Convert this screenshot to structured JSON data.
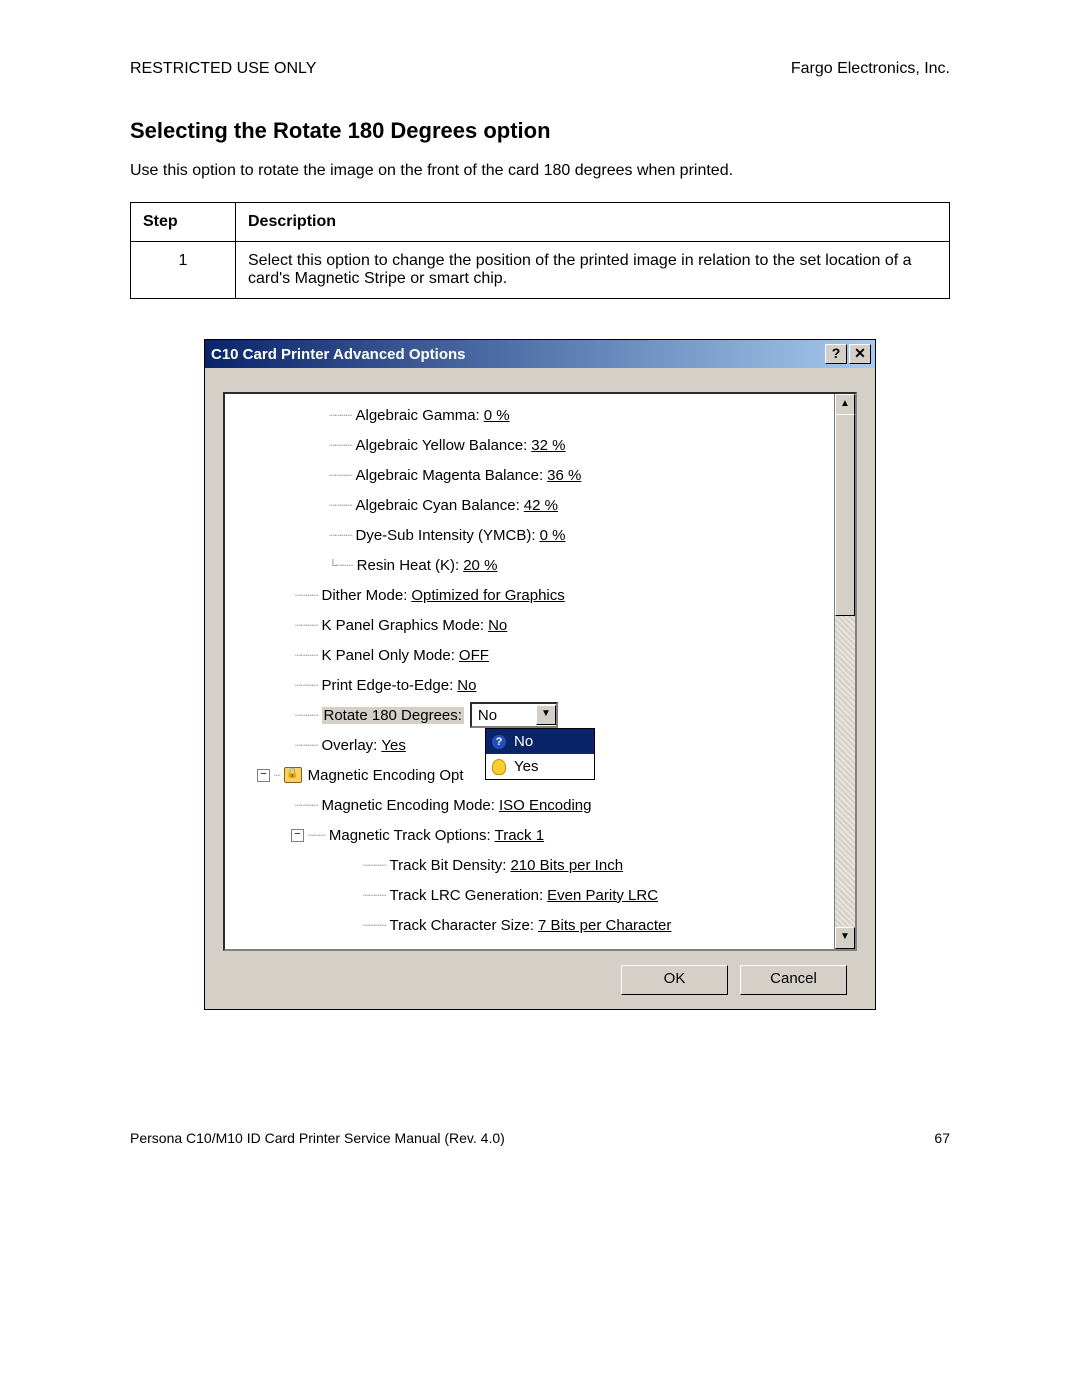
{
  "doc": {
    "restricted": "RESTRICTED USE ONLY",
    "company": "Fargo Electronics, Inc.",
    "heading": "Selecting the Rotate 180 Degrees option",
    "intro": "Use this option to rotate the image on the front of the card 180 degrees when printed.",
    "table": {
      "h_step": "Step",
      "h_desc": "Description",
      "r1_step": "1",
      "r1_desc": "Select this option to change the position of the printed image in relation to the set location of a card's Magnetic Stripe or smart chip."
    },
    "footer_left": "Persona C10/M10 ID Card Printer Service Manual (Rev. 4.0)",
    "page_num": "67"
  },
  "dialog": {
    "title": "C10 Card Printer Advanced Options",
    "help_glyph": "?",
    "close_glyph": "✕",
    "ok": "OK",
    "cancel": "Cancel",
    "scroll_up": "▲",
    "scroll_down": "▼",
    "dd_arrow": "▼",
    "expand_minus": "−",
    "tree": {
      "alg_gamma_lbl": "Algebraic Gamma: ",
      "alg_gamma_val": "0 %",
      "alg_yellow_lbl": "Algebraic Yellow Balance: ",
      "alg_yellow_val": "32 %",
      "alg_magenta_lbl": "Algebraic Magenta Balance: ",
      "alg_magenta_val": "36 %",
      "alg_cyan_lbl": "Algebraic Cyan Balance: ",
      "alg_cyan_val": "42 %",
      "dyesub_lbl": "Dye-Sub Intensity (YMCB): ",
      "dyesub_val": "0 %",
      "resin_lbl": "Resin Heat (K): ",
      "resin_val": "20 %",
      "dither_lbl": "Dither Mode: ",
      "dither_val": "Optimized for Graphics",
      "kpanel_g_lbl": "K Panel Graphics Mode: ",
      "kpanel_g_val": "No",
      "kpanel_o_lbl": "K Panel Only Mode: ",
      "kpanel_o_val": "OFF",
      "edge_lbl": "Print Edge-to-Edge: ",
      "edge_val": "No",
      "rotate_lbl": "Rotate 180 Degrees:",
      "rotate_sel": "No",
      "rotate_opt_no": "No",
      "rotate_opt_yes": "Yes",
      "overlay_lbl": "Overlay: ",
      "overlay_val": "Yes",
      "magenc_lbl": "Magnetic Encoding Opt",
      "magmode_lbl": "Magnetic Encoding Mode: ",
      "magmode_val": "ISO Encoding",
      "magtrack_lbl": "Magnetic Track Options: ",
      "magtrack_val": "Track 1",
      "bitden_lbl": "Track Bit Density: ",
      "bitden_val": "210 Bits per Inch",
      "lrc_lbl": "Track LRC Generation: ",
      "lrc_val": "Even Parity LRC",
      "charsize_lbl": "Track Character Size: ",
      "charsize_val": "7 Bits per Character"
    }
  }
}
